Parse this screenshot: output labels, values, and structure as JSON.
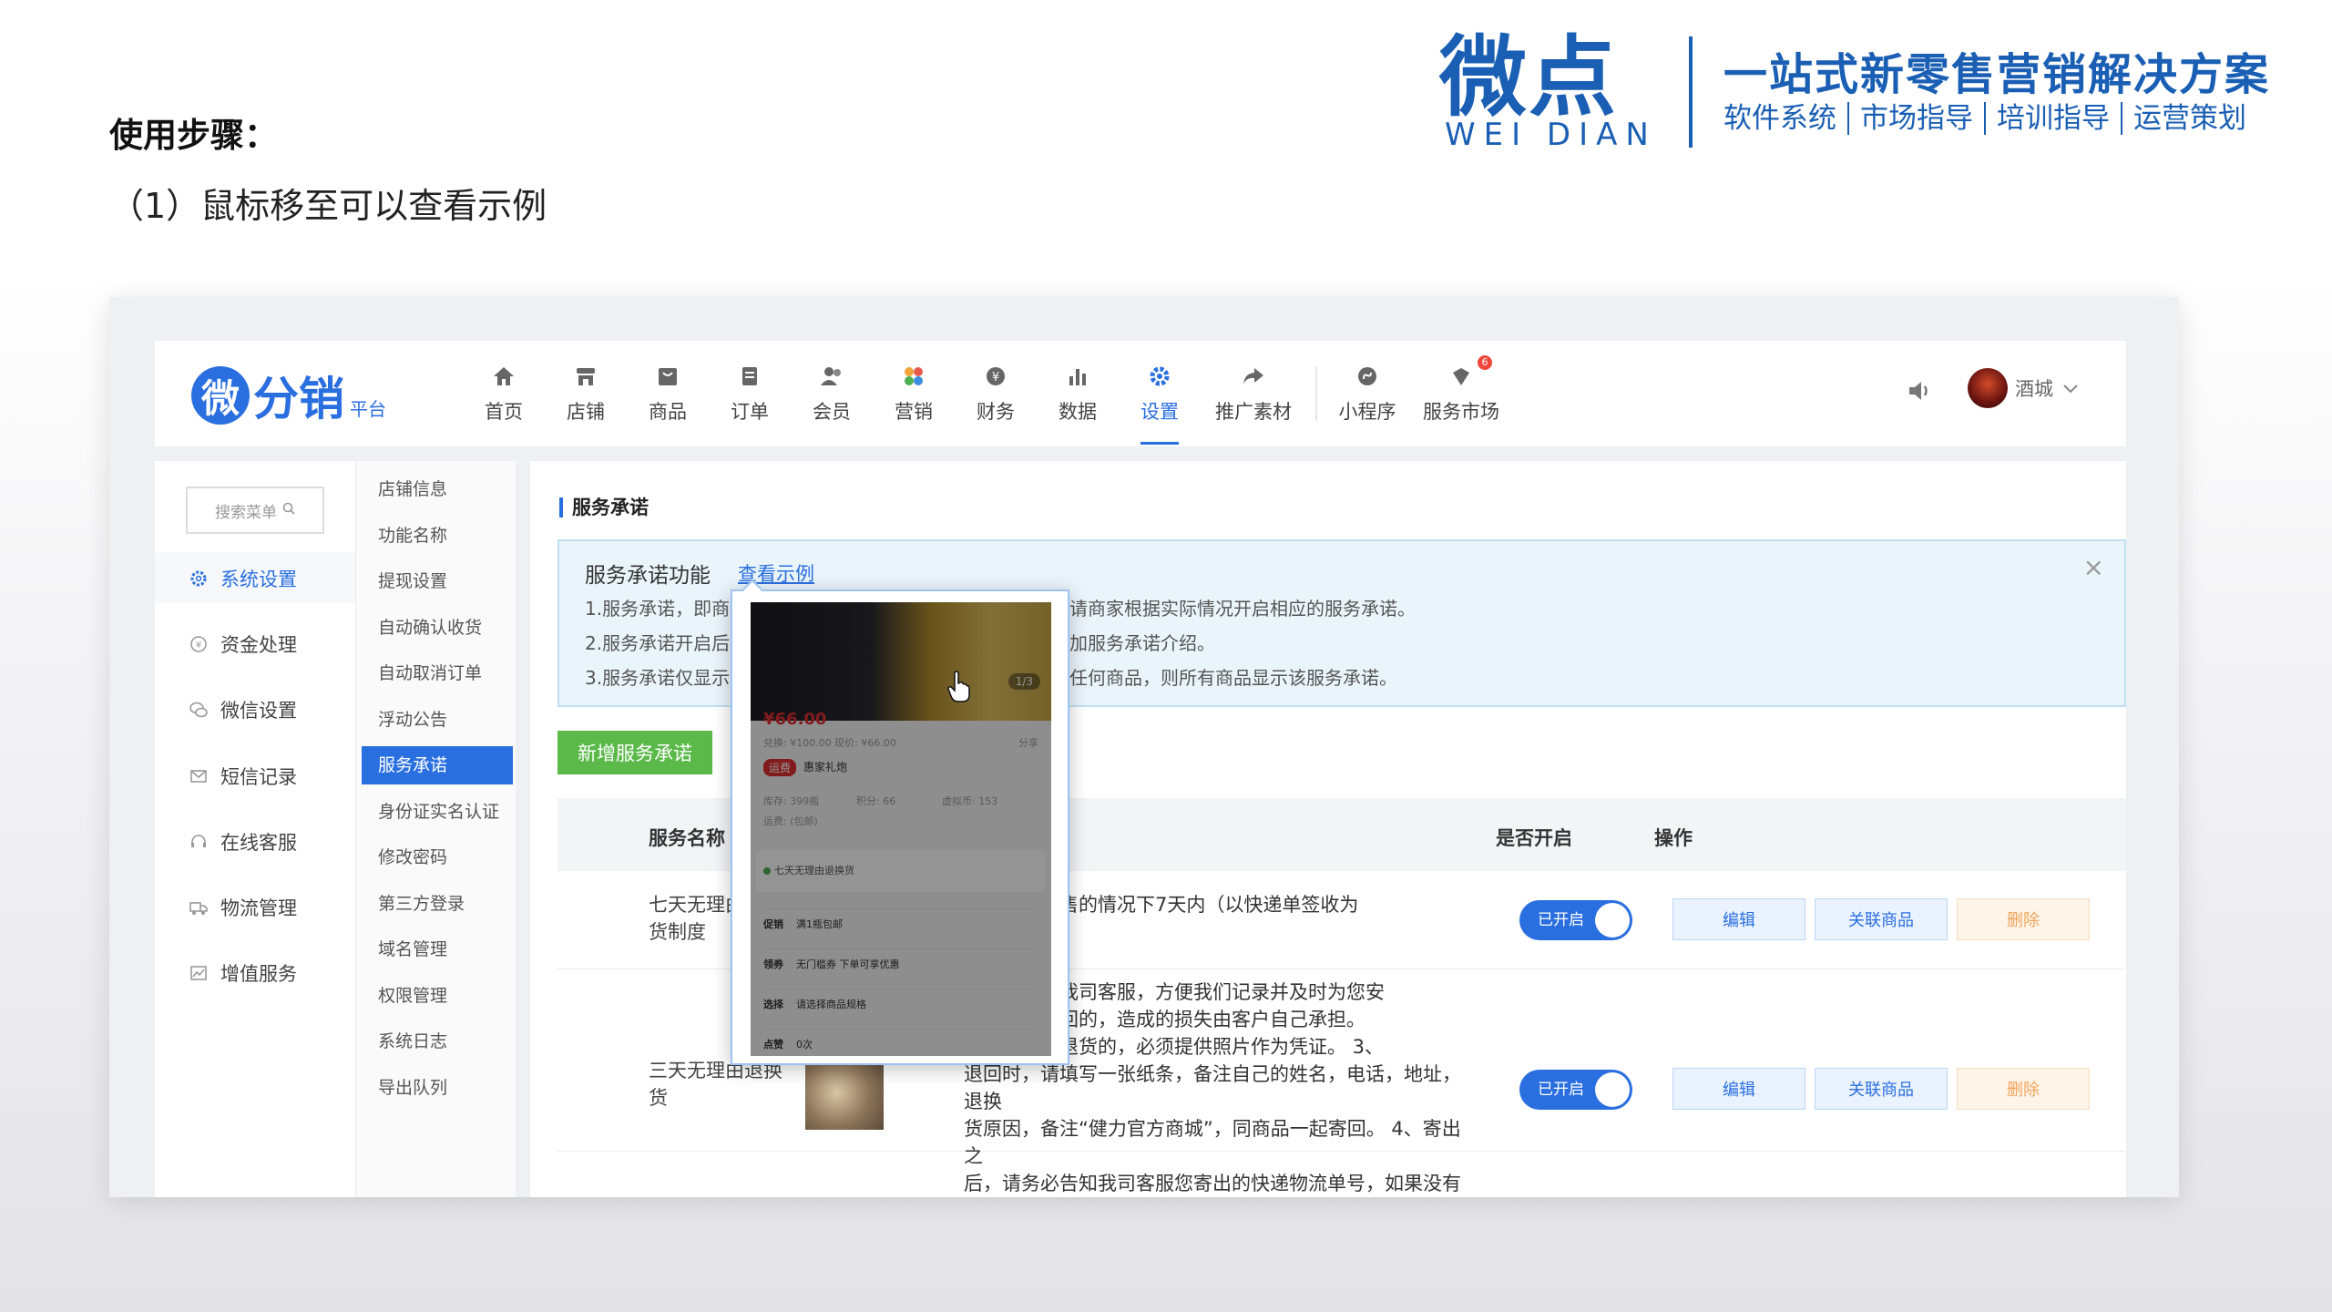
{
  "slide": {
    "title": "使用步骤：",
    "step": "（1）鼠标移至可以查看示例"
  },
  "brand": {
    "logo_cn": "微点",
    "logo_en": "WEI DIAN",
    "slogan": "一站式新零售营销解决方案",
    "services": [
      "软件系统",
      "市场指导",
      "培训指导",
      "运营策划"
    ]
  },
  "app": {
    "logo_mark": "微",
    "logo_text": "分销",
    "logo_sub": "平台",
    "nav": [
      {
        "label": "首页",
        "icon": "home-icon"
      },
      {
        "label": "店铺",
        "icon": "store-icon"
      },
      {
        "label": "商品",
        "icon": "goods-icon"
      },
      {
        "label": "订单",
        "icon": "order-icon"
      },
      {
        "label": "会员",
        "icon": "member-icon"
      },
      {
        "label": "营销",
        "icon": "marketing-icon"
      },
      {
        "label": "财务",
        "icon": "finance-icon"
      },
      {
        "label": "数据",
        "icon": "chart-icon"
      },
      {
        "label": "设置",
        "icon": "gear-icon",
        "active": true
      },
      {
        "label": "推广素材",
        "icon": "share-icon"
      },
      {
        "label": "小程序",
        "icon": "miniapp-icon"
      },
      {
        "label": "服务市场",
        "icon": "market-icon",
        "badge": "6"
      }
    ],
    "user_name": "酒城",
    "accent": "#2a6fe0"
  },
  "left_menu": {
    "search_placeholder": "搜索菜单",
    "items": [
      {
        "label": "系统设置",
        "icon": "gear-icon",
        "active": true
      },
      {
        "label": "资金处理",
        "icon": "coin-icon"
      },
      {
        "label": "微信设置",
        "icon": "wechat-icon"
      },
      {
        "label": "短信记录",
        "icon": "mail-icon"
      },
      {
        "label": "在线客服",
        "icon": "headset-icon"
      },
      {
        "label": "物流管理",
        "icon": "truck-icon"
      },
      {
        "label": "增值服务",
        "icon": "trend-icon"
      }
    ]
  },
  "sub_menu": {
    "items": [
      "店铺信息",
      "功能名称",
      "提现设置",
      "自动确认收货",
      "自动取消订单",
      "浮动公告",
      "服务承诺",
      "身份证实名认证",
      "修改密码",
      "第三方登录",
      "域名管理",
      "权限管理",
      "系统日志",
      "导出队列"
    ],
    "active_index": 6
  },
  "content": {
    "section_title": "服务承诺",
    "notice": {
      "head": "服务承诺功能",
      "link": "查看示例",
      "lines_left": [
        "1.服务承诺，即商",
        "2.服务承诺开启后",
        "3.服务承诺仅显示"
      ],
      "lines_right": [
        "请商家根据实际情况开启相应的服务承诺。",
        "加服务承诺介绍。",
        "任何商品，则所有商品显示该服务承诺。"
      ]
    },
    "add_button": "新增服务承诺",
    "table": {
      "headers": {
        "name": "服务名称",
        "enabled": "是否开启",
        "ops": "操作"
      },
      "rows": [
        {
          "name": "七天无理由退货制度",
          "name_visible": "七天无理由\n货制度",
          "desc": "影响二次销售的情况下7天内（以快递单签收为\n客户退换货",
          "toggle": "已开启",
          "ops": [
            "编辑",
            "关联商品",
            "删除"
          ]
        },
        {
          "name": "三天无理由退换货",
          "desc": "商品前联系我司客服，方便我们记录并及时为您安\n联系直接寄回的，造成的损失由客户自己承担。\n量问题需要退货的，必须提供照片作为凭证。 3、\n退回时，请填写一张纸条，备注自己的姓名，电话，地址，退换\n货原因，备注“健力官方商城”，同商品一起寄回。 4、寄出之\n后，请务必告知我司客服您寄出的快递物流单号，如果没有单号",
          "toggle": "已开启",
          "ops": [
            "编辑",
            "关联商品",
            "删除"
          ]
        }
      ]
    }
  },
  "popup": {
    "pager": "1/3",
    "price": "¥66.00",
    "orig": "兑换: ¥100.00  现价: ¥66.00",
    "share": "分享",
    "tag": "运费",
    "tag_text": "惠家礼炮",
    "stock": "库存: 399瓶",
    "points": "积分: 66",
    "virtual": "虚拟币: 153",
    "sales": "运费: (包邮)",
    "promise": "七天无理由退换货",
    "rows": [
      {
        "k": "促销",
        "v": "满1瓶包邮"
      },
      {
        "k": "领券",
        "v": "无门槛券  下单可享优惠"
      },
      {
        "k": "选择",
        "v": "请选择商品规格"
      },
      {
        "k": "点赞",
        "v": "0次"
      }
    ]
  }
}
